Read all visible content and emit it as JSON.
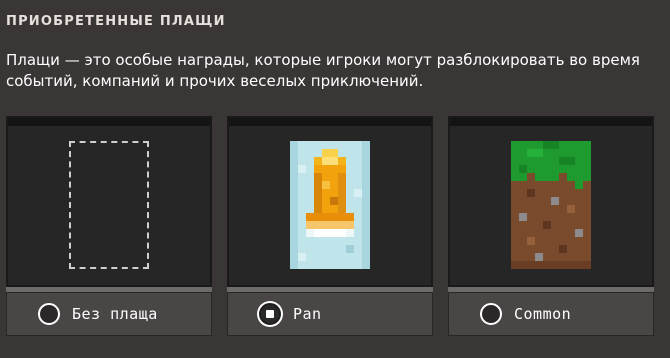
{
  "section": {
    "heading": "ПРИОБРЕТЕННЫЕ ПЛАЩИ",
    "description": "Плащи — это особые награды, которые игроки могут разблокировать во время событий, компаний и прочих веселых приключений."
  },
  "capes": [
    {
      "label": "Без плаща",
      "selected": false,
      "icon": "empty-cape-slot-icon"
    },
    {
      "label": "Pan",
      "selected": true,
      "icon": "pan-cape-icon"
    },
    {
      "label": "Common",
      "selected": false,
      "icon": "common-cape-icon"
    }
  ],
  "colors": {
    "background": "#3a3636",
    "card_preview": "#262626",
    "card_bar": "#4a4646",
    "pan_cape_bg": "#bfe4ea",
    "pan_cape_orange": "#f2a20c",
    "common_cape_grass": "#1e9a2e",
    "common_cape_dirt": "#7a4a2c"
  }
}
